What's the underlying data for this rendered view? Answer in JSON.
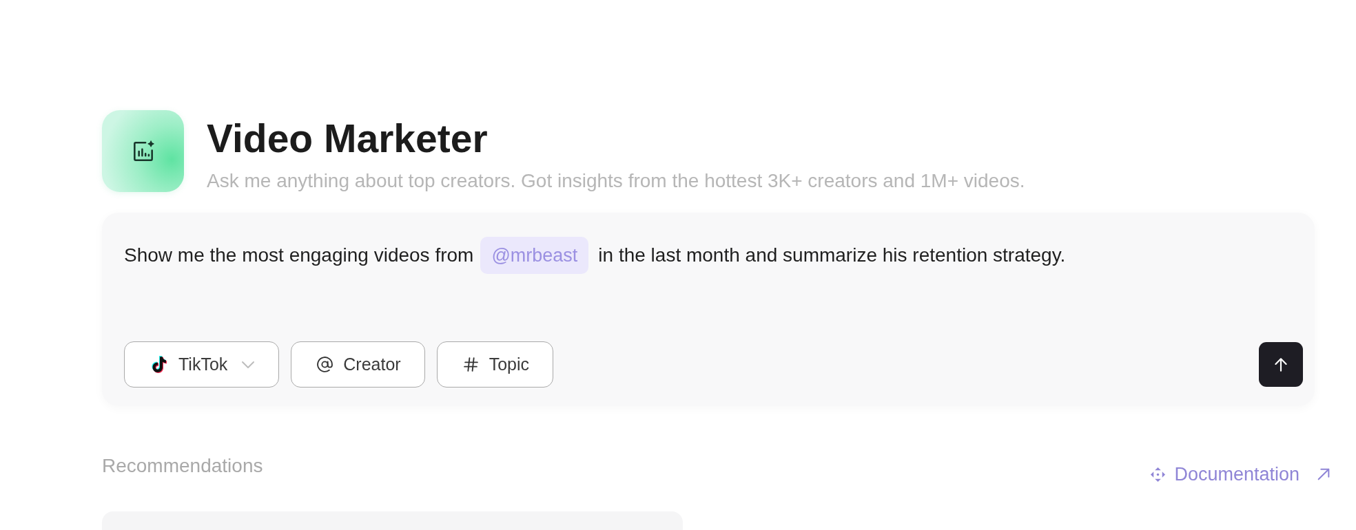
{
  "assistant": {
    "title": "Video Marketer",
    "subtitle": "Ask me anything about top creators. Got insights from the hottest 3K+ creators and 1M+ videos."
  },
  "composer": {
    "segments": [
      {
        "kind": "text",
        "text": "Show me the most engaging videos from"
      },
      {
        "kind": "mention",
        "text": "@mrbeast"
      },
      {
        "kind": "text",
        "text": "in the last month and summarize his retention strategy."
      }
    ],
    "filters": [
      {
        "kind": "platform",
        "label": "TikTok",
        "dropdown": true
      },
      {
        "kind": "mention",
        "label": "Creator",
        "dropdown": false
      },
      {
        "kind": "hashtag",
        "label": "Topic",
        "dropdown": false
      }
    ]
  },
  "recommendations": {
    "heading": "Recommendations",
    "link": "Documentation"
  }
}
